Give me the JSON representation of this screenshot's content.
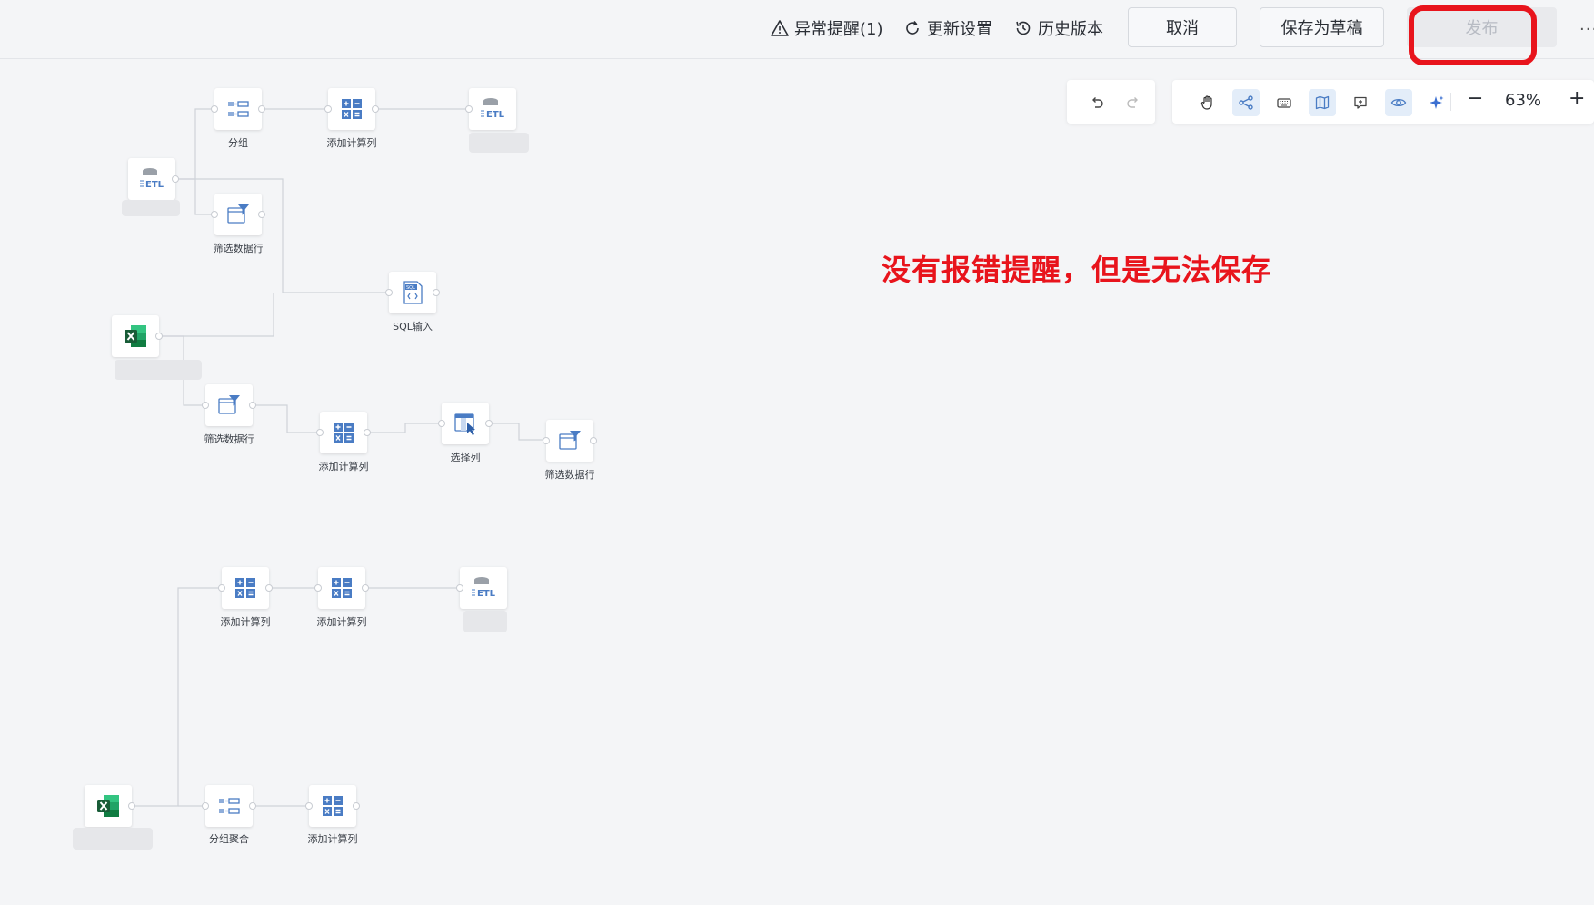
{
  "toolbar": {
    "alert_label": "异常提醒(1)",
    "update_settings_label": "更新设置",
    "history_label": "历史版本",
    "cancel_label": "取消",
    "save_draft_label": "保存为草稿",
    "publish_label": "发布",
    "more_label": "···"
  },
  "canvas_tools": {
    "undo_icon": "undo-icon",
    "redo_icon": "redo-icon",
    "hand_icon": "hand-icon",
    "flow_icon": "flow-icon",
    "keyboard_icon": "keyboard-icon",
    "map_icon": "map-icon",
    "comment_icon": "comment-icon",
    "preview_icon": "eye-icon",
    "ai_icon": "sparkle-icon",
    "zoom_level": "63%",
    "zoom_out_label": "−",
    "zoom_in_label": "+"
  },
  "annotation": "没有报错提醒，但是无法保存",
  "nodes": {
    "group1": "分组",
    "calc1": "添加计算列",
    "filter1": "筛选数据行",
    "sql": "SQL输入",
    "filter2": "筛选数据行",
    "calc2": "添加计算列",
    "select": "选择列",
    "filter3": "筛选数据行",
    "calc3": "添加计算列",
    "calc4": "添加计算列",
    "groupagg": "分组聚合",
    "calc5": "添加计算列"
  },
  "colors": {
    "accent": "#4a7cc4",
    "red": "#e8141c",
    "excel_green": "#1e7145"
  }
}
